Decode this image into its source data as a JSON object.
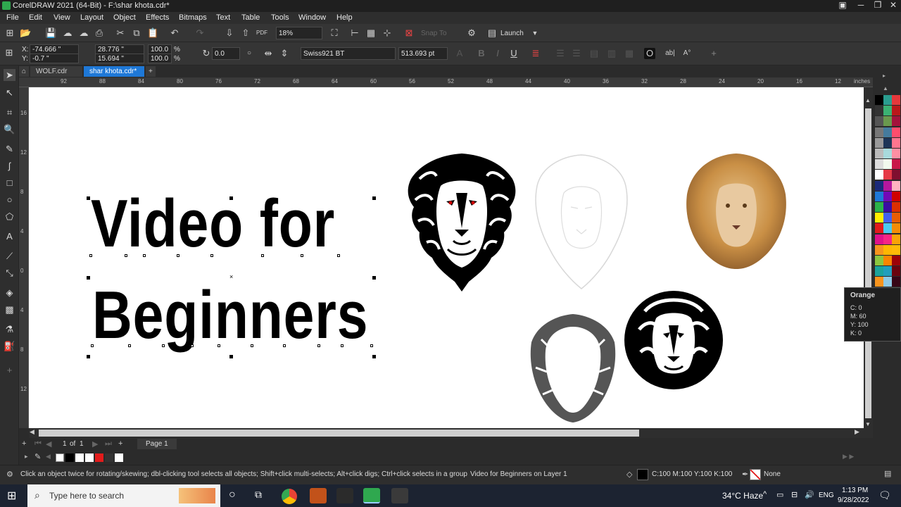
{
  "window": {
    "title": "CorelDRAW 2021 (64-Bit) - F:\\shar khota.cdr*"
  },
  "menu": [
    "File",
    "Edit",
    "View",
    "Layout",
    "Object",
    "Effects",
    "Bitmaps",
    "Text",
    "Table",
    "Tools",
    "Window",
    "Help"
  ],
  "toolbar": {
    "zoom": "18%",
    "snap_to": "Snap To",
    "launch": "Launch"
  },
  "property_bar": {
    "x": "-74.666 \"",
    "y": "-0.7 \"",
    "width": "28.776 \"",
    "height": "15.694 \"",
    "scale_w": "100.0",
    "scale_h": "100.0",
    "pct": "%",
    "rotation": "0.0",
    "font_name": "Swiss921 BT",
    "font_size": "513.693 pt",
    "x_label": "X:",
    "y_label": "Y:"
  },
  "doc_tabs": [
    "WOLF.cdr",
    "shar khota.cdr*"
  ],
  "ruler": {
    "h_ticks": [
      "92",
      "88",
      "84",
      "80",
      "76",
      "72",
      "68",
      "64",
      "60",
      "56",
      "52",
      "48",
      "44",
      "40",
      "36",
      "32",
      "28",
      "24",
      "20",
      "16",
      "12"
    ],
    "unit": "inches",
    "v_ticks": [
      "16",
      "12",
      "8",
      "4",
      "0",
      "4",
      "8",
      "12"
    ]
  },
  "canvas": {
    "line1": "Video for",
    "line2": "Beginners"
  },
  "page_nav": {
    "current": "1",
    "of": "of",
    "total": "1",
    "page_tab": "Page 1"
  },
  "tooltip": {
    "name": "Orange",
    "c": "C: 0",
    "m": "M: 60",
    "y": "Y: 100",
    "k": "K: 0"
  },
  "status": {
    "hint": "Click an object twice for rotating/skewing; dbl-clicking tool selects all objects; Shift+click multi-selects; Alt+click digs; Ctrl+click selects in a group",
    "object_info": "Video for Beginners  on Layer 1",
    "fill_info": "C:100 M:100 Y:100 K:100",
    "outline_info": "None"
  },
  "taskbar": {
    "search_placeholder": "Type here to search",
    "weather": "34°C  Haze",
    "lang": "ENG",
    "time": "1:13 PM",
    "date": "9/28/2022"
  },
  "colors": {
    "accent": "#1e78d7",
    "tooltip_orange": "#f7941d"
  }
}
